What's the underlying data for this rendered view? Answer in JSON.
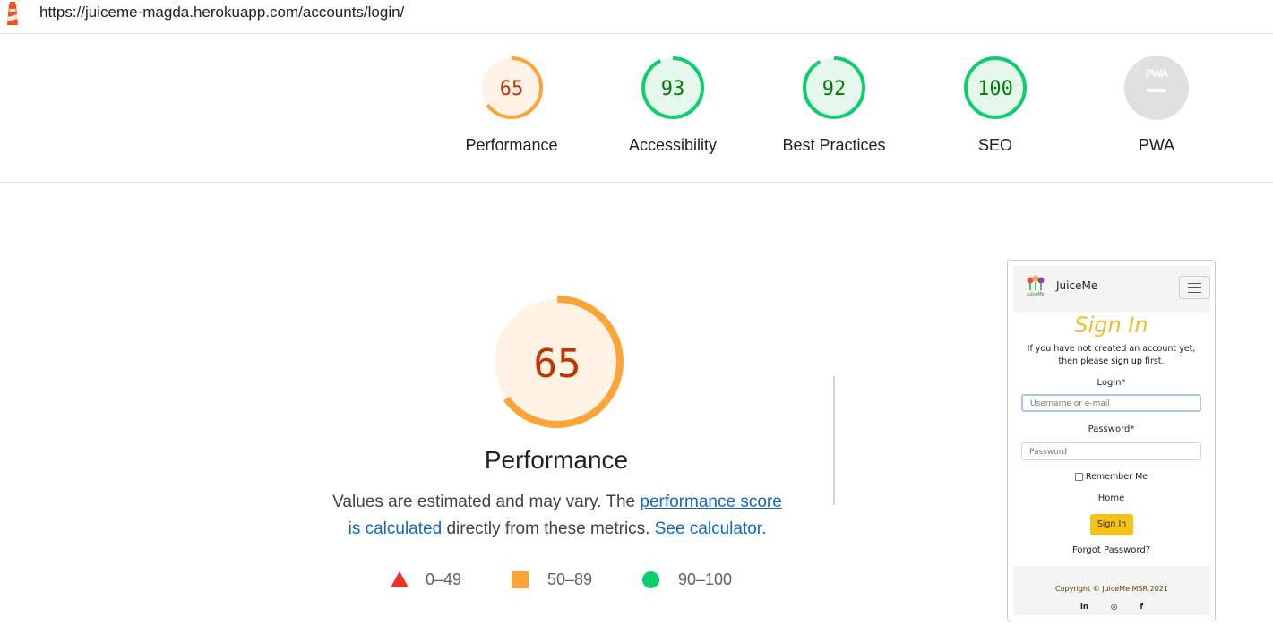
{
  "url": "https://juiceme-magda.herokuapp.com/accounts/login/",
  "colors": {
    "fail": "#eb3328",
    "average": "#fca437",
    "pass": "#0cce6b",
    "average_text": "#c33300",
    "pass_text": "#008000",
    "na": "#e0e0e0"
  },
  "gauges": [
    {
      "label": "Performance",
      "score": "65",
      "fraction": 0.65,
      "rating": "average"
    },
    {
      "label": "Accessibility",
      "score": "93",
      "fraction": 0.93,
      "rating": "pass"
    },
    {
      "label": "Best Practices",
      "score": "92",
      "fraction": 0.92,
      "rating": "pass"
    },
    {
      "label": "SEO",
      "score": "100",
      "fraction": 1.0,
      "rating": "pass"
    },
    {
      "label": "PWA",
      "score": "",
      "fraction": 0,
      "rating": "na"
    }
  ],
  "performance": {
    "score": "65",
    "fraction": 0.65,
    "title": "Performance",
    "desc_prefix": "Values are estimated and may vary. The ",
    "desc_link": "performance score is calculated",
    "desc_middle": " directly from these metrics. ",
    "calculator_link": "See calculator."
  },
  "legend": {
    "fail": "0–49",
    "average": "50–89",
    "pass": "90–100"
  },
  "thumbnail": {
    "brand": "JuiceMe",
    "heading": "Sign In",
    "note_prefix": "If you have not created an account yet, then please ",
    "note_link": "sign up",
    "note_suffix": " first.",
    "login_label": "Login*",
    "login_placeholder": "Username or e-mail",
    "password_label": "Password*",
    "password_placeholder": "Password",
    "remember": "Remember Me",
    "home": "Home",
    "signin_button": "Sign In",
    "forgot": "Forgot Password?",
    "copyright": "Copyright © JuiceMe MSR 2021",
    "social": [
      "in",
      "◎",
      "f"
    ]
  }
}
